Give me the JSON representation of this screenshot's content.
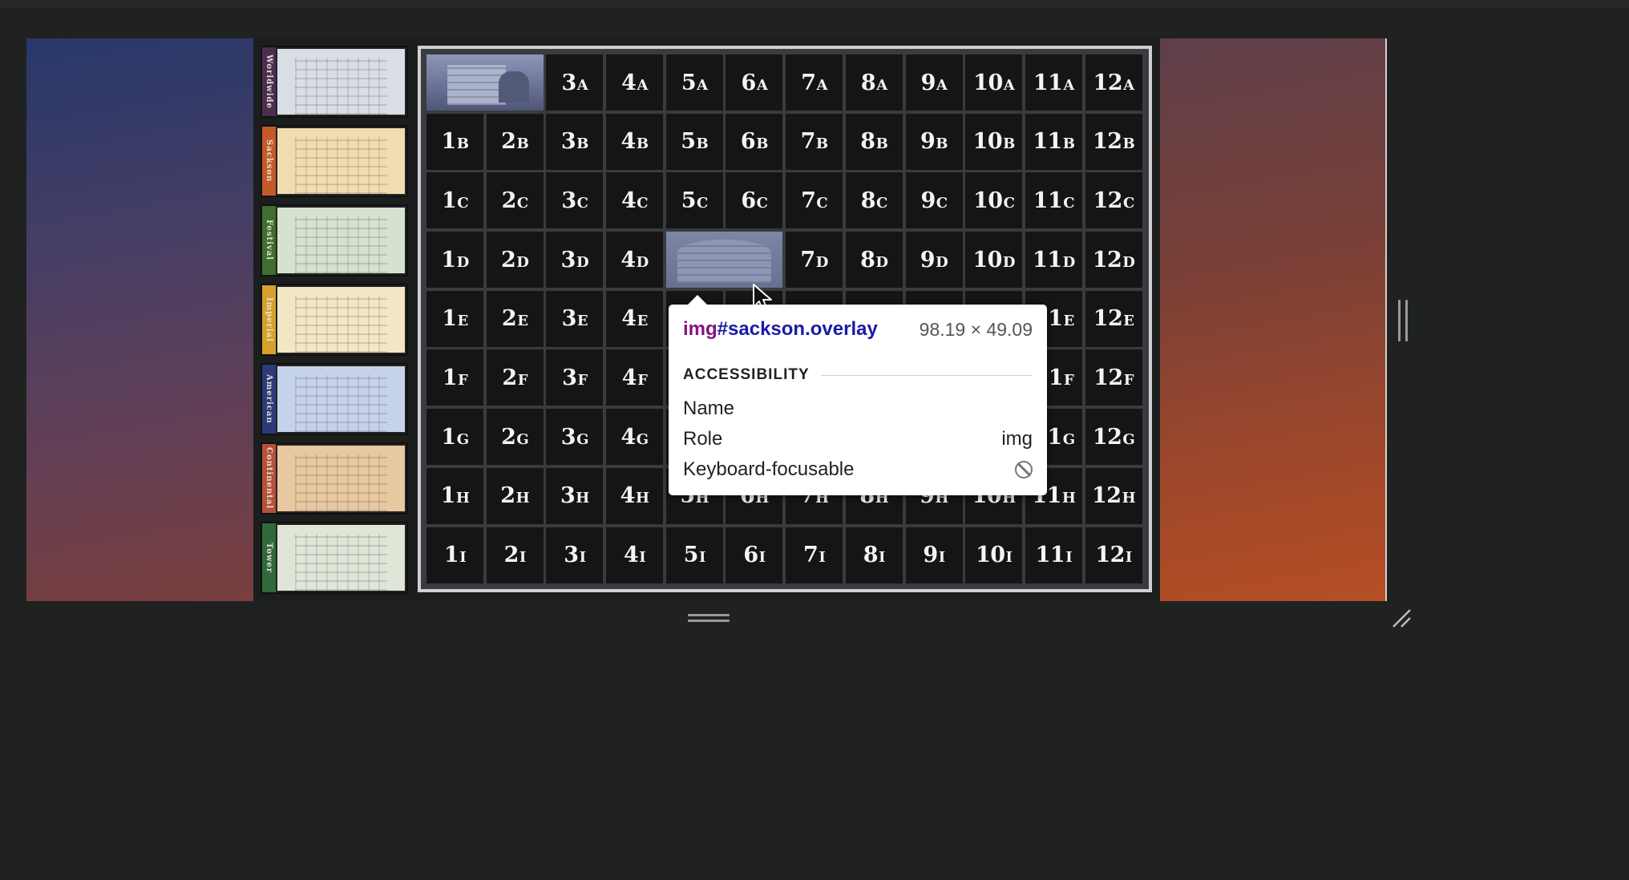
{
  "chains": [
    {
      "name": "Worldwide",
      "spine_color": "#4a2e4f",
      "picture_color": "#d9dde6"
    },
    {
      "name": "Sackson",
      "spine_color": "#c45a2a",
      "picture_color": "#f0dcb0"
    },
    {
      "name": "Festival",
      "spine_color": "#3f6e2e",
      "picture_color": "#d5e2cf"
    },
    {
      "name": "Imperial",
      "spine_color": "#d6a22c",
      "picture_color": "#f2e6c4"
    },
    {
      "name": "American",
      "spine_color": "#2b3b79",
      "picture_color": "#c6d2ea"
    },
    {
      "name": "Continental",
      "spine_color": "#b5503a",
      "picture_color": "#e8c8a0"
    },
    {
      "name": "Tower",
      "spine_color": "#2e6a3c",
      "picture_color": "#dfe6d8"
    }
  ],
  "board": {
    "columns": [
      "1",
      "2",
      "3",
      "4",
      "5",
      "6",
      "7",
      "8",
      "9",
      "10",
      "11",
      "12"
    ],
    "rows": [
      "A",
      "B",
      "C",
      "D",
      "E",
      "F",
      "G",
      "H",
      "I"
    ],
    "placed_tiles": [
      {
        "label": "1A",
        "chain": "worldwide"
      },
      {
        "label": "2A",
        "chain": "worldwide"
      },
      {
        "label": "5D",
        "chain": "sackson"
      },
      {
        "label": "6D",
        "chain": "sackson"
      }
    ]
  },
  "inspector": {
    "tag": "img",
    "id_class": "#sackson.overlay",
    "dimensions": "98.19 × 49.09",
    "section_title": "ACCESSIBILITY",
    "rows": [
      {
        "label": "Name",
        "value": ""
      },
      {
        "label": "Role",
        "value": "img"
      },
      {
        "label": "Keyboard-focusable",
        "value": "",
        "icon": "not-allowed-icon"
      }
    ]
  }
}
